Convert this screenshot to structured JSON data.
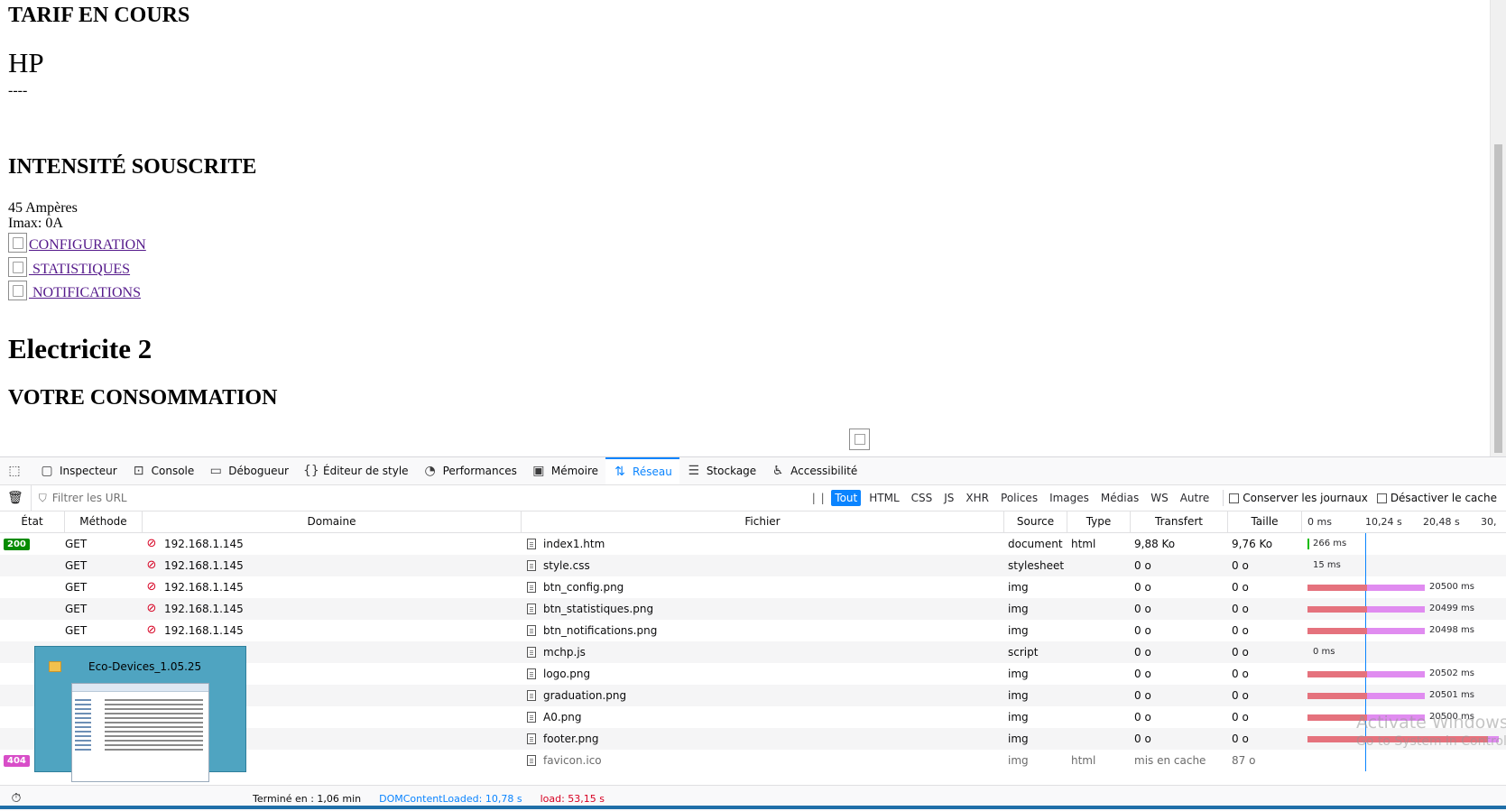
{
  "page": {
    "tarif_heading": "TARIF EN COURS",
    "tarif_value": "HP",
    "dashes": "----",
    "intensite_heading": "INTENSITÉ SOUSCRITE",
    "amperes": "45 Ampères",
    "imax": "Imax: 0A",
    "links": [
      {
        "label": "CONFIGURATION"
      },
      {
        "label": " STATISTIQUES"
      },
      {
        "label": " NOTIFICATIONS"
      }
    ],
    "title": "Electricite 2",
    "consommation_heading": "VOTRE CONSOMMATION"
  },
  "devtools": {
    "tabs": [
      {
        "label": "Inspecteur",
        "icon": "inspector-icon"
      },
      {
        "label": "Console",
        "icon": "console-icon"
      },
      {
        "label": "Débogueur",
        "icon": "debugger-icon"
      },
      {
        "label": "Éditeur de style",
        "icon": "style-editor-icon"
      },
      {
        "label": "Performances",
        "icon": "performance-icon"
      },
      {
        "label": "Mémoire",
        "icon": "memory-icon"
      },
      {
        "label": "Réseau",
        "icon": "network-icon",
        "active": true
      },
      {
        "label": "Stockage",
        "icon": "storage-icon"
      },
      {
        "label": "Accessibilité",
        "icon": "accessibility-icon"
      }
    ],
    "filter_placeholder": "Filtrer les URL",
    "pause_label": "| |",
    "filter_types": [
      "Tout",
      "HTML",
      "CSS",
      "JS",
      "XHR",
      "Polices",
      "Images",
      "Médias",
      "WS",
      "Autre"
    ],
    "persist_logs_label": "Conserver les journaux",
    "disable_cache_label": "Désactiver le cache",
    "columns": {
      "etat": "État",
      "methode": "Méthode",
      "domaine": "Domaine",
      "fichier": "Fichier",
      "source": "Source",
      "type": "Type",
      "transfert": "Transfert",
      "taille": "Taille"
    },
    "waterfall_ticks": [
      "0 ms",
      "10,24 s",
      "20,48 s",
      "30,"
    ],
    "requests": [
      {
        "status": "200",
        "method": "GET",
        "domain": "192.168.1.145",
        "file": "index1.htm",
        "source": "document",
        "type": "html",
        "transfer": "9,88 Ko",
        "size": "9,76 Ko",
        "wf_label": "266 ms",
        "wf_kind": "tiny"
      },
      {
        "status": "",
        "method": "GET",
        "domain": "192.168.1.145",
        "file": "style.css",
        "source": "stylesheet",
        "type": "",
        "transfer": "0 o",
        "size": "0 o",
        "wf_label": "15 ms",
        "wf_kind": "none"
      },
      {
        "status": "",
        "method": "GET",
        "domain": "192.168.1.145",
        "file": "btn_config.png",
        "source": "img",
        "type": "",
        "transfer": "0 o",
        "size": "0 o",
        "wf_label": "20500 ms",
        "wf_kind": "long"
      },
      {
        "status": "",
        "method": "GET",
        "domain": "192.168.1.145",
        "file": "btn_statistiques.png",
        "source": "img",
        "type": "",
        "transfer": "0 o",
        "size": "0 o",
        "wf_label": "20499 ms",
        "wf_kind": "long"
      },
      {
        "status": "",
        "method": "GET",
        "domain": "192.168.1.145",
        "file": "btn_notifications.png",
        "source": "img",
        "type": "",
        "transfer": "0 o",
        "size": "0 o",
        "wf_label": "20498 ms",
        "wf_kind": "long"
      },
      {
        "status": "",
        "method": "",
        "domain": "",
        "file": "mchp.js",
        "source": "script",
        "type": "",
        "transfer": "0 o",
        "size": "0 o",
        "wf_label": "0 ms",
        "wf_kind": "none"
      },
      {
        "status": "",
        "method": "",
        "domain": "",
        "file": "logo.png",
        "source": "img",
        "type": "",
        "transfer": "0 o",
        "size": "0 o",
        "wf_label": "20502 ms",
        "wf_kind": "long"
      },
      {
        "status": "",
        "method": "",
        "domain": "",
        "file": "graduation.png",
        "source": "img",
        "type": "",
        "transfer": "0 o",
        "size": "0 o",
        "wf_label": "20501 ms",
        "wf_kind": "long"
      },
      {
        "status": "",
        "method": "",
        "domain": "",
        "file": "A0.png",
        "source": "img",
        "type": "",
        "transfer": "0 o",
        "size": "0 o",
        "wf_label": "20500 ms",
        "wf_kind": "long"
      },
      {
        "status": "",
        "method": "",
        "domain": "",
        "file": "footer.png",
        "source": "img",
        "type": "",
        "transfer": "0 o",
        "size": "0 o",
        "wf_label": "",
        "wf_kind": "full"
      },
      {
        "status": "404",
        "method": "",
        "domain": "",
        "file": "favicon.ico",
        "source": "img",
        "type": "html",
        "transfer": "mis en cache",
        "size": "87 o",
        "wf_label": "",
        "wf_kind": "none",
        "muted": true
      }
    ],
    "statusbar": {
      "finished": "Terminé en : 1,06 min",
      "dcl": "DOMContentLoaded: 10,78 s",
      "load": "load: 53,15 s"
    }
  },
  "taskbar_thumbnail": {
    "title": "Eco-Devices_1.05.25"
  },
  "watermark": {
    "line1": "Activate Windows",
    "line2": "Go to System in Control"
  },
  "colors": {
    "accent": "#0a84ff",
    "status_ok": "#058b00",
    "status_404": "#d84ec8",
    "wf_blocked": "#e5727d",
    "wf_waiting": "#e08cf0",
    "link_visited": "#551a8b"
  }
}
